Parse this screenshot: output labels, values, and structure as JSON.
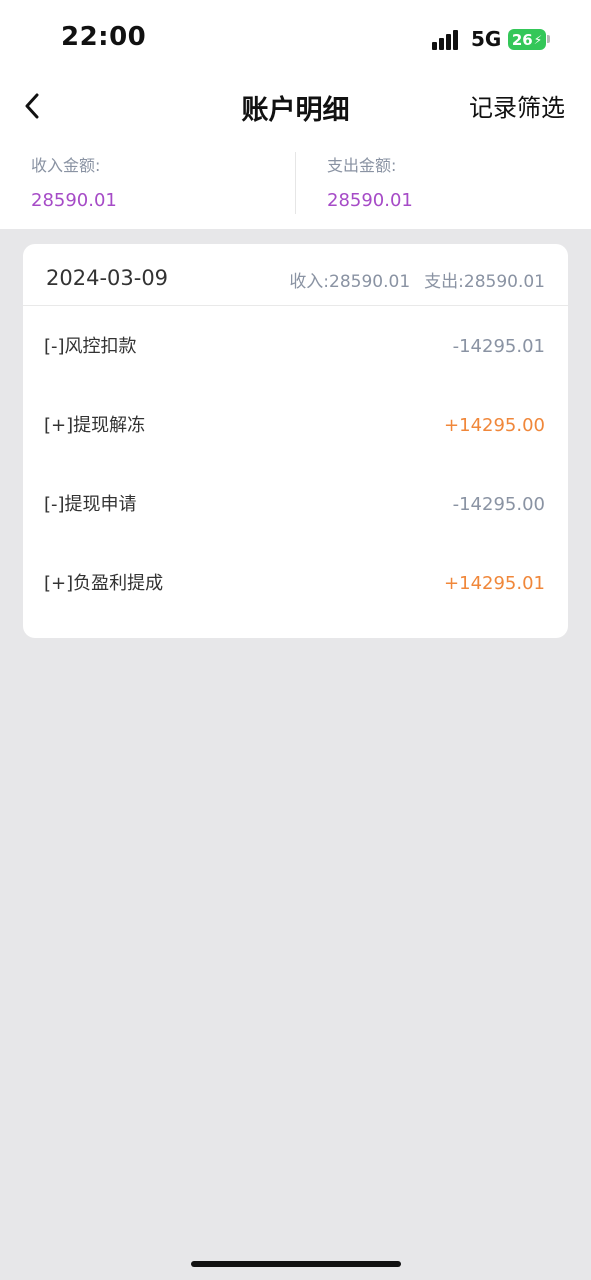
{
  "status_bar": {
    "time": "22:00",
    "network": "5G",
    "battery": "26"
  },
  "nav": {
    "back_icon": "chevron-left-icon",
    "title": "账户明细",
    "filter_label": "记录筛选"
  },
  "summary": {
    "income_label": "收入金额:",
    "income_value": "28590.01",
    "expense_label": "支出金额:",
    "expense_value": "28590.01",
    "value_color": "#a64bc7"
  },
  "day_group": {
    "date": "2024-03-09",
    "income_total": "收入:28590.01",
    "expense_total": "支出:28590.01",
    "records": [
      {
        "label": "[-]风控扣款",
        "amount": "-14295.01",
        "color": "#8a93a3"
      },
      {
        "label": "[+]提现解冻",
        "amount": "+14295.00",
        "color": "#f0873a"
      },
      {
        "label": "[-]提现申请",
        "amount": "-14295.00",
        "color": "#8a93a3"
      },
      {
        "label": "[+]负盈利提成",
        "amount": "+14295.01",
        "color": "#f0873a"
      }
    ]
  }
}
